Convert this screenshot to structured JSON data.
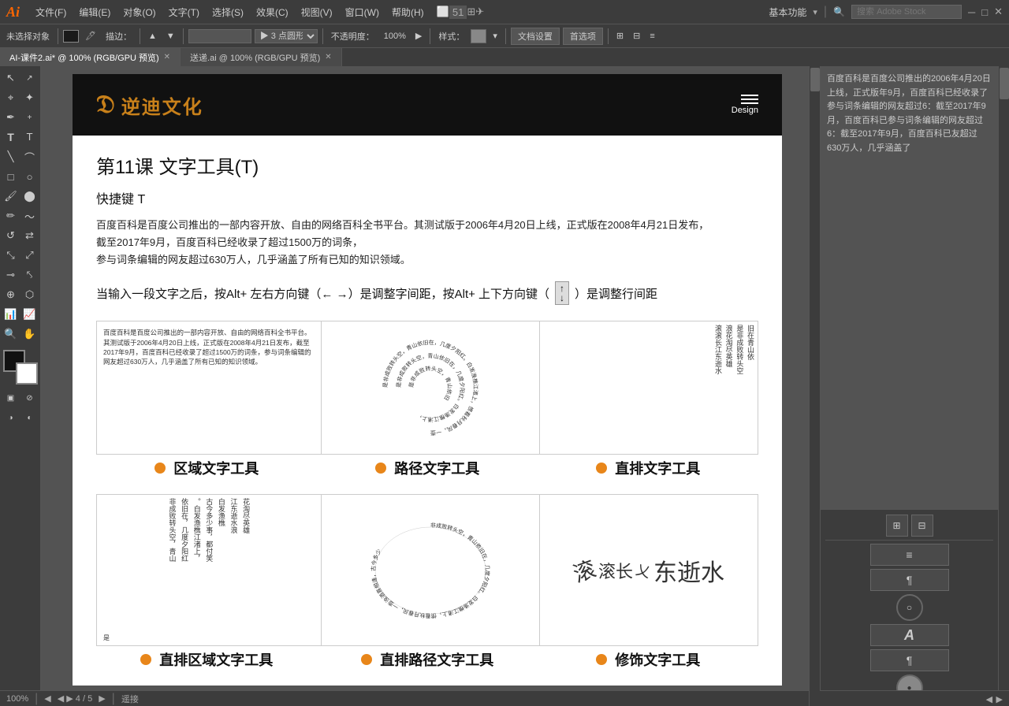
{
  "app": {
    "logo": "Ai",
    "logo_color": "#ff6600"
  },
  "menu": {
    "items": [
      "文件(F)",
      "编辑(E)",
      "对象(O)",
      "文字(T)",
      "选择(S)",
      "效果(C)",
      "视图(V)",
      "窗口(W)",
      "帮助(H)"
    ]
  },
  "menu_right": {
    "workspace": "基本功能",
    "search_placeholder": "搜索 Adobe Stock"
  },
  "toolbar": {
    "no_selection": "未选择对象",
    "stroke": "描边：",
    "points": "▶ 3 点圆形",
    "opacity_label": "不透明度：",
    "opacity_value": "100%",
    "style_label": "样式：",
    "doc_settings": "文档设置",
    "preferences": "首选项"
  },
  "tabs": [
    {
      "label": "AI-课件2.ai* @ 100% (RGB/GPU 预览)",
      "active": true
    },
    {
      "label": "送递.ai @ 100% (RGB/GPU 预览)",
      "active": false
    }
  ],
  "document": {
    "logo_text": "逆迪文化",
    "design_label": "Design",
    "lesson_title": "第11课   文字工具(T)",
    "shortcut": "快捷键 T",
    "desc_line1": "百度百科是百度公司推出的一部内容开放、自由的网络百科全书平台。其测试版于2006年4月20日上线，正式版在2008年4月21日发布，",
    "desc_line2": "截至2017年9月，百度百科已经收录了超过1500万的词条，",
    "desc_line3": "参与词条编辑的网友超过630万人，几乎涵盖了所有已知的知识领域。",
    "alt_note": "当输入一段文字之后，按Alt+ 左右方向键（← →）是调整字间距，按Alt+ 上下方向键（  ）是调整行间距",
    "demo_labels": [
      "区域文字工具",
      "路径文字工具",
      "直排文字工具"
    ],
    "demo_labels2": [
      "直排区域文字工具",
      "直排路径文字工具",
      "修饰文字工具"
    ],
    "baidu_text": "百度百科是百度公司推出的一部内容开放、自由的网络百科全书平台。其测试版于2006年4月20日上线，正式版在2008年4月21日发布，截至2017年9月，百度百科已经收录了超过1500万的词条，参与词条编辑的网友超过630万人，几乎涵盖了所有已知的知识领域。",
    "poem_text": "非成败转头空，青山依旧在，几度夕阳红。白发渔樵江渚上，惯看秋月春风。一壶浊酒喜相逢，古今多少事，都付笑谈中。"
  },
  "right_panel": {
    "text": "百度百科是百度公司推出的2006年4月20日上线，正式版年9月，百度百科已经收录了参与词条编辑的网友超过6：截至2017年9月，百度百科已参与词条编辑的网友超过6：截至2017年9月，百度百科已友超过630万人，几乎涵盖了"
  },
  "status": {
    "zoom": "100%",
    "artboard_nav": "◀ ▶ 4 / 5",
    "position_label": "遥接",
    "playback": "◀ ▶"
  }
}
